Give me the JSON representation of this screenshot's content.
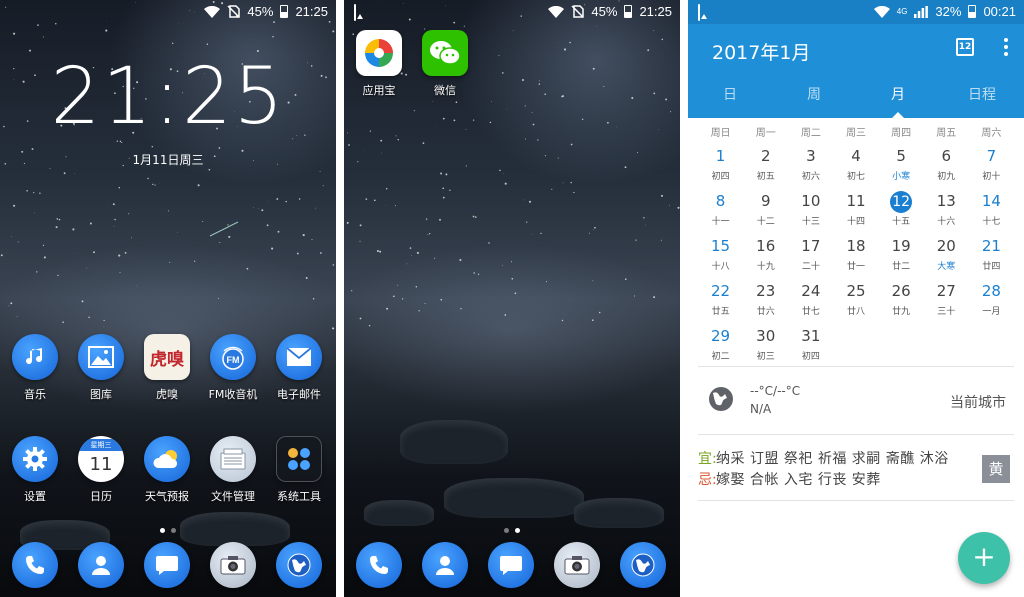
{
  "lockscreen": {
    "status": {
      "battery": "45%",
      "time": "21:25"
    },
    "clock": "21:25",
    "date": "1月11日周三",
    "apps_row1": [
      {
        "label": "音乐",
        "icon": "music-icon"
      },
      {
        "label": "图库",
        "icon": "gallery-icon"
      },
      {
        "label": "虎嗅",
        "icon": "huxiu-icon"
      },
      {
        "label": "FM收音机",
        "icon": "fm-radio-icon"
      },
      {
        "label": "电子邮件",
        "icon": "email-icon"
      }
    ],
    "apps_row2": [
      {
        "label": "设置",
        "icon": "settings-gear-icon"
      },
      {
        "label": "日历",
        "icon": "calendar-icon",
        "badge_week": "星期三",
        "badge_day": "11"
      },
      {
        "label": "天气预报",
        "icon": "weather-icon"
      },
      {
        "label": "文件管理",
        "icon": "file-manager-icon"
      },
      {
        "label": "系统工具",
        "icon": "system-tools-folder-icon"
      }
    ],
    "dock": [
      "phone-icon",
      "contacts-icon",
      "messages-icon",
      "camera-icon",
      "browser-icon"
    ]
  },
  "homescreen2": {
    "status": {
      "battery": "45%",
      "time": "21:25"
    },
    "apps": [
      {
        "label": "应用宝",
        "icon": "yingyongbao-icon"
      },
      {
        "label": "微信",
        "icon": "wechat-icon"
      }
    ],
    "dock": [
      "phone-icon",
      "contacts-icon",
      "messages-icon",
      "camera-icon",
      "browser-icon"
    ]
  },
  "calendar": {
    "status": {
      "battery": "32%",
      "time": "00:21",
      "network": "4G"
    },
    "title": "2017年1月",
    "today_icon_day": "12",
    "tabs": [
      "日",
      "周",
      "月",
      "日程"
    ],
    "active_tab": "月",
    "weekdays": [
      "周日",
      "周一",
      "周二",
      "周三",
      "周四",
      "周五",
      "周六"
    ],
    "days": [
      {
        "n": "1",
        "l": "初四"
      },
      {
        "n": "2",
        "l": "初五"
      },
      {
        "n": "3",
        "l": "初六"
      },
      {
        "n": "4",
        "l": "初七"
      },
      {
        "n": "5",
        "l": "小寒"
      },
      {
        "n": "6",
        "l": "初九"
      },
      {
        "n": "7",
        "l": "初十"
      },
      {
        "n": "8",
        "l": "十一"
      },
      {
        "n": "9",
        "l": "十二"
      },
      {
        "n": "10",
        "l": "十三"
      },
      {
        "n": "11",
        "l": "十四"
      },
      {
        "n": "12",
        "l": "十五"
      },
      {
        "n": "13",
        "l": "十六"
      },
      {
        "n": "14",
        "l": "十七"
      },
      {
        "n": "15",
        "l": "十八"
      },
      {
        "n": "16",
        "l": "十九"
      },
      {
        "n": "17",
        "l": "二十"
      },
      {
        "n": "18",
        "l": "廿一"
      },
      {
        "n": "19",
        "l": "廿二"
      },
      {
        "n": "20",
        "l": "大寒"
      },
      {
        "n": "21",
        "l": "廿四"
      },
      {
        "n": "22",
        "l": "廿五"
      },
      {
        "n": "23",
        "l": "廿六"
      },
      {
        "n": "24",
        "l": "廿七"
      },
      {
        "n": "25",
        "l": "廿八"
      },
      {
        "n": "26",
        "l": "廿九"
      },
      {
        "n": "27",
        "l": "三十"
      },
      {
        "n": "28",
        "l": "一月"
      },
      {
        "n": "29",
        "l": "初二"
      },
      {
        "n": "30",
        "l": "初三"
      },
      {
        "n": "31",
        "l": "初四"
      }
    ],
    "today": "12",
    "solar_terms": [
      "小寒",
      "大寒"
    ],
    "weather": {
      "temp": "--°C/--°C",
      "na": "N/A",
      "city": "当前城市"
    },
    "almanac": {
      "yi_tag": "宜:",
      "yi": "纳采 订盟 祭祀 祈福 求嗣 斋醮 沐浴",
      "ji_tag": "忌:",
      "ji": "嫁娶 合帐 入宅 行丧 安葬",
      "badge": "黄"
    },
    "fab": "+",
    "colors": {
      "header": "#1f8fd8",
      "accent": "#1a7fd0",
      "fab": "#3dc1a8"
    }
  }
}
